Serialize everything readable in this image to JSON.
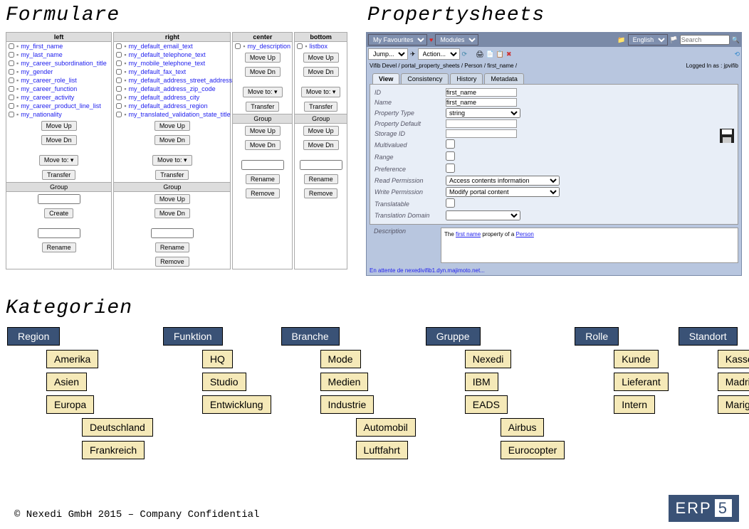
{
  "titles": {
    "formulare": "Formulare",
    "propertysheets": "Propertysheets",
    "kategorien": "Kategorien"
  },
  "formulare": {
    "cols": [
      {
        "header": "left",
        "items": [
          "my_first_name",
          "my_last_name",
          "my_career_subordination_title",
          "my_gender",
          "my_career_role_list",
          "my_career_function",
          "my_career_activity",
          "my_career_product_line_list",
          "my_nationality"
        ]
      },
      {
        "header": "right",
        "items": [
          "my_default_email_text",
          "my_default_telephone_text",
          "my_mobile_telephone_text",
          "my_default_fax_text",
          "my_default_address_street_address",
          "my_default_address_zip_code",
          "my_default_address_city",
          "my_default_address_region",
          "my_translated_validation_state_title"
        ]
      },
      {
        "header": "center",
        "items": [
          "my_description"
        ]
      },
      {
        "header": "bottom",
        "items": [
          "listbox"
        ]
      }
    ],
    "buttons": {
      "moveup": "Move Up",
      "movedn": "Move Dn",
      "moveto": "Move to: ▾",
      "transfer": "Transfer",
      "group": "Group",
      "create": "Create",
      "rename": "Rename",
      "remove": "Remove"
    }
  },
  "propsheet": {
    "toolbar1": {
      "favourites": "My Favourites",
      "modules": "Modules",
      "lang": "English",
      "search": "Search"
    },
    "toolbar2": {
      "jump": "Jump...",
      "action": "Action..."
    },
    "breadcrumb": "Vifib Devel / portal_property_sheets / Person / first_name /",
    "loggedin": "Logged In as : jpvifib",
    "tabs": [
      "View",
      "Consistency",
      "History",
      "Metadata"
    ],
    "fields": {
      "id": {
        "label": "ID",
        "value": "first_name"
      },
      "name": {
        "label": "Name",
        "value": "first_name"
      },
      "proptype": {
        "label": "Property Type",
        "value": "string"
      },
      "propdefault": {
        "label": "Property Default",
        "value": ""
      },
      "storageid": {
        "label": "Storage ID",
        "value": ""
      },
      "multivalued": {
        "label": "Multivalued"
      },
      "range": {
        "label": "Range"
      },
      "preference": {
        "label": "Preference"
      },
      "readperm": {
        "label": "Read Permission",
        "value": "Access contents information"
      },
      "writeperm": {
        "label": "Write Permission",
        "value": "Modify portal content"
      },
      "translatable": {
        "label": "Translatable"
      },
      "transdomain": {
        "label": "Translation Domain",
        "value": ""
      }
    },
    "desc": {
      "label": "Description",
      "text_pre": "The ",
      "link1": "first name",
      "mid": " property of a ",
      "link2": "Person"
    },
    "footer": "En attente de nexedivifib1.dyn.majimoto.net..."
  },
  "kategorien": {
    "trees": [
      {
        "root": "Region",
        "children": [
          "Amerika",
          "Asien",
          "Europa"
        ],
        "sub": {
          "parent": "Europa",
          "items": [
            "Deutschland",
            "Frankreich"
          ]
        }
      },
      {
        "root": "Funktion",
        "children": [
          "HQ",
          "Studio",
          "Entwicklung"
        ]
      },
      {
        "root": "Branche",
        "children": [
          "Mode",
          "Medien",
          "Industrie"
        ],
        "sub": {
          "parent": "Industrie",
          "items": [
            "Automobil",
            "Luftfahrt"
          ]
        }
      },
      {
        "root": "Gruppe",
        "children": [
          "Nexedi",
          "IBM",
          "EADS"
        ],
        "sub": {
          "parent": "EADS",
          "items": [
            "Airbus",
            "Eurocopter"
          ]
        }
      },
      {
        "root": "Rolle",
        "children": [
          "Kunde",
          "Lieferant",
          "Intern"
        ]
      },
      {
        "root": "Standort",
        "children": [
          "Kassel",
          "Madrid",
          "Marignane"
        ]
      }
    ]
  },
  "footer": "© Nexedi GmbH 2015 – Company Confidential",
  "logo": {
    "text": "ERP",
    "num": "5"
  }
}
